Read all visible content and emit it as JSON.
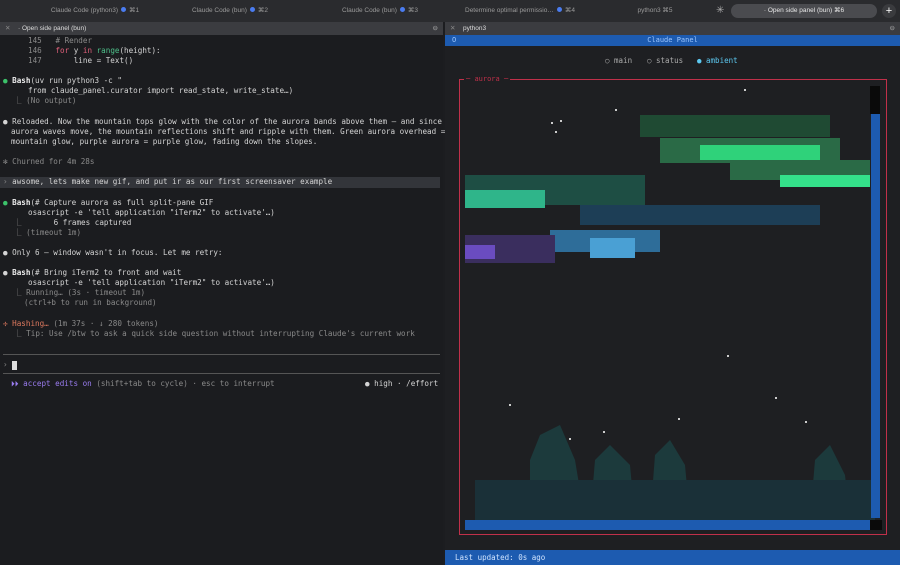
{
  "tabs": [
    {
      "label": "Claude Code (python3)",
      "shortcut": "⌘1",
      "dot": true
    },
    {
      "label": "Claude Code (bun)",
      "shortcut": "⌘2",
      "dot": true
    },
    {
      "label": "Claude Code (bun)",
      "shortcut": "⌘3",
      "dot": true
    },
    {
      "label": "Determine optimal permissio…",
      "shortcut": "⌘4",
      "dot": true
    },
    {
      "label": "python3",
      "shortcut": "⌘5",
      "dot": false
    },
    {
      "label": "· Open side panel (bun)",
      "shortcut": "⌘6",
      "dot": false
    }
  ],
  "left_pane": {
    "title": "· Open side panel (bun)",
    "code": [
      {
        "num": "145",
        "text": "# Render"
      },
      {
        "num": "146",
        "kw": "for",
        "mid": " y ",
        "kw2": "in",
        "fn": "range",
        "rest": "(height):"
      },
      {
        "num": "147",
        "text": "    line = Text()"
      }
    ],
    "bash1": {
      "tool": "Bash",
      "cmd": "(uv run python3 -c \"",
      "cmd2": "from claude_panel.curator import read_state, write_state…)",
      "out": "(No output)"
    },
    "msg1": [
      "Reloaded. Now the mountain tops glow with the color of the aurora bands above them — and since the",
      "aurora waves move, the mountain reflections shift and ripple with them. Green aurora overhead = green",
      "mountain glow, purple aurora = purple glow, fading down the slopes."
    ],
    "churned": "Churned for 4m 28s",
    "user_prompt": "awsome, lets make new gif, and put ir as our first screensaver example",
    "bash2": {
      "tool": "Bash",
      "cmd": "(# Capture aurora as full split-pane GIF",
      "cmd2": "osascript -e 'tell application \"iTerm2\" to activate'…)",
      "out": "      6 frames captured",
      "out2": "(timeout 1m)"
    },
    "msg2": "Only 6 — window wasn't in focus. Let me retry:",
    "bash3": {
      "tool": "Bash",
      "cmd": "(# Bring iTerm2 to front and wait",
      "cmd2": "osascript -e 'tell application \"iTerm2\" to activate'…)",
      "out": "Running… (3s · timeout 1m)",
      "out2": "(ctrl+b to run in background)"
    },
    "status": {
      "verb": "Hashing…",
      "detail": "(1m 37s · ↓ 280 tokens)",
      "tip": "Tip: Use /btw to ask a quick side question without interrupting Claude's current work"
    },
    "prompt_symbol": "›",
    "footer": {
      "mode": "⏵⏵ accept edits on",
      "hint": "(shift+tab to cycle) · esc to interrupt",
      "effort": "● high · /effort"
    }
  },
  "right_pane": {
    "title": "python3",
    "panel_title": "Claude Panel",
    "panel_indicator": "O",
    "radios": [
      {
        "label": "main",
        "selected": false
      },
      {
        "label": "status",
        "selected": false
      },
      {
        "label": "ambient",
        "selected": true
      }
    ],
    "frame_label": "aurora",
    "last_updated": "Last updated: 0s ago"
  }
}
